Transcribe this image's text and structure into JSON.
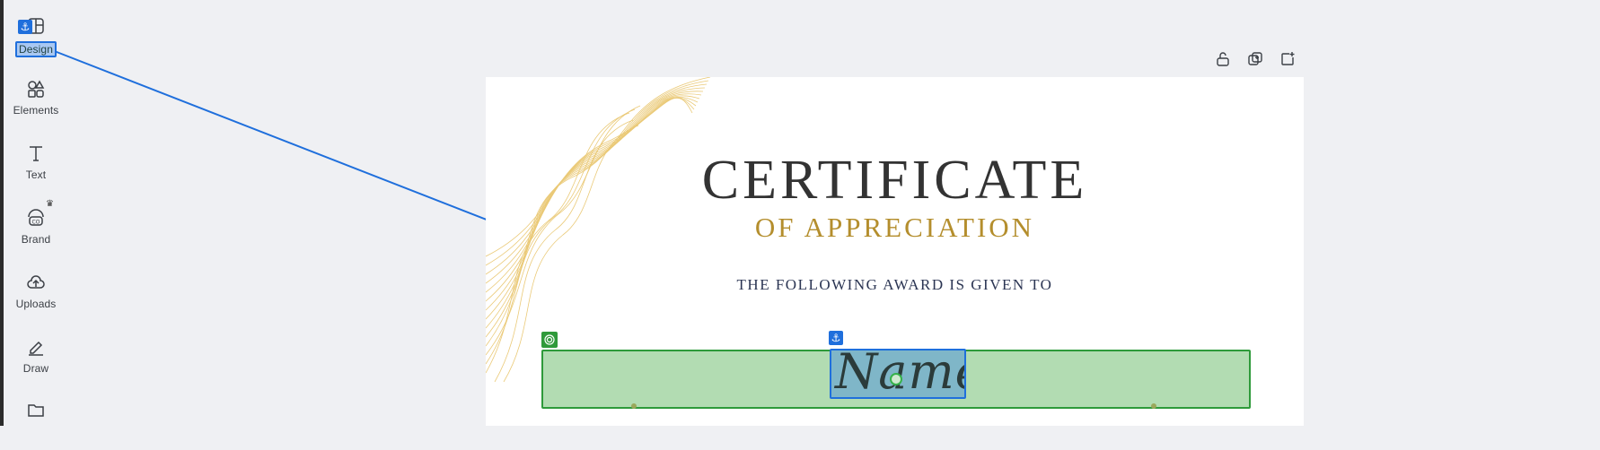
{
  "sidebar": {
    "items": [
      {
        "label": "Design",
        "icon": "design-icon"
      },
      {
        "label": "Elements",
        "icon": "elements-icon"
      },
      {
        "label": "Text",
        "icon": "text-icon"
      },
      {
        "label": "Brand",
        "icon": "brand-icon"
      },
      {
        "label": "Uploads",
        "icon": "uploads-icon"
      },
      {
        "label": "Draw",
        "icon": "draw-icon"
      },
      {
        "label": "",
        "icon": "folder-icon"
      }
    ]
  },
  "page_tools": [
    "lock-icon",
    "duplicate-page-icon",
    "add-page-icon"
  ],
  "certificate": {
    "title": "CERTIFICATE",
    "subtitle": "OF APPRECIATION",
    "award_line": "THE FOLLOWING AWARD IS GIVEN TO",
    "name": "Name"
  },
  "colors": {
    "title": "#333333",
    "subtitle": "#b48e2d",
    "award_line": "#2b3553",
    "selection_blue": "#1f6fdc",
    "group_green": "#2e9a3a"
  }
}
